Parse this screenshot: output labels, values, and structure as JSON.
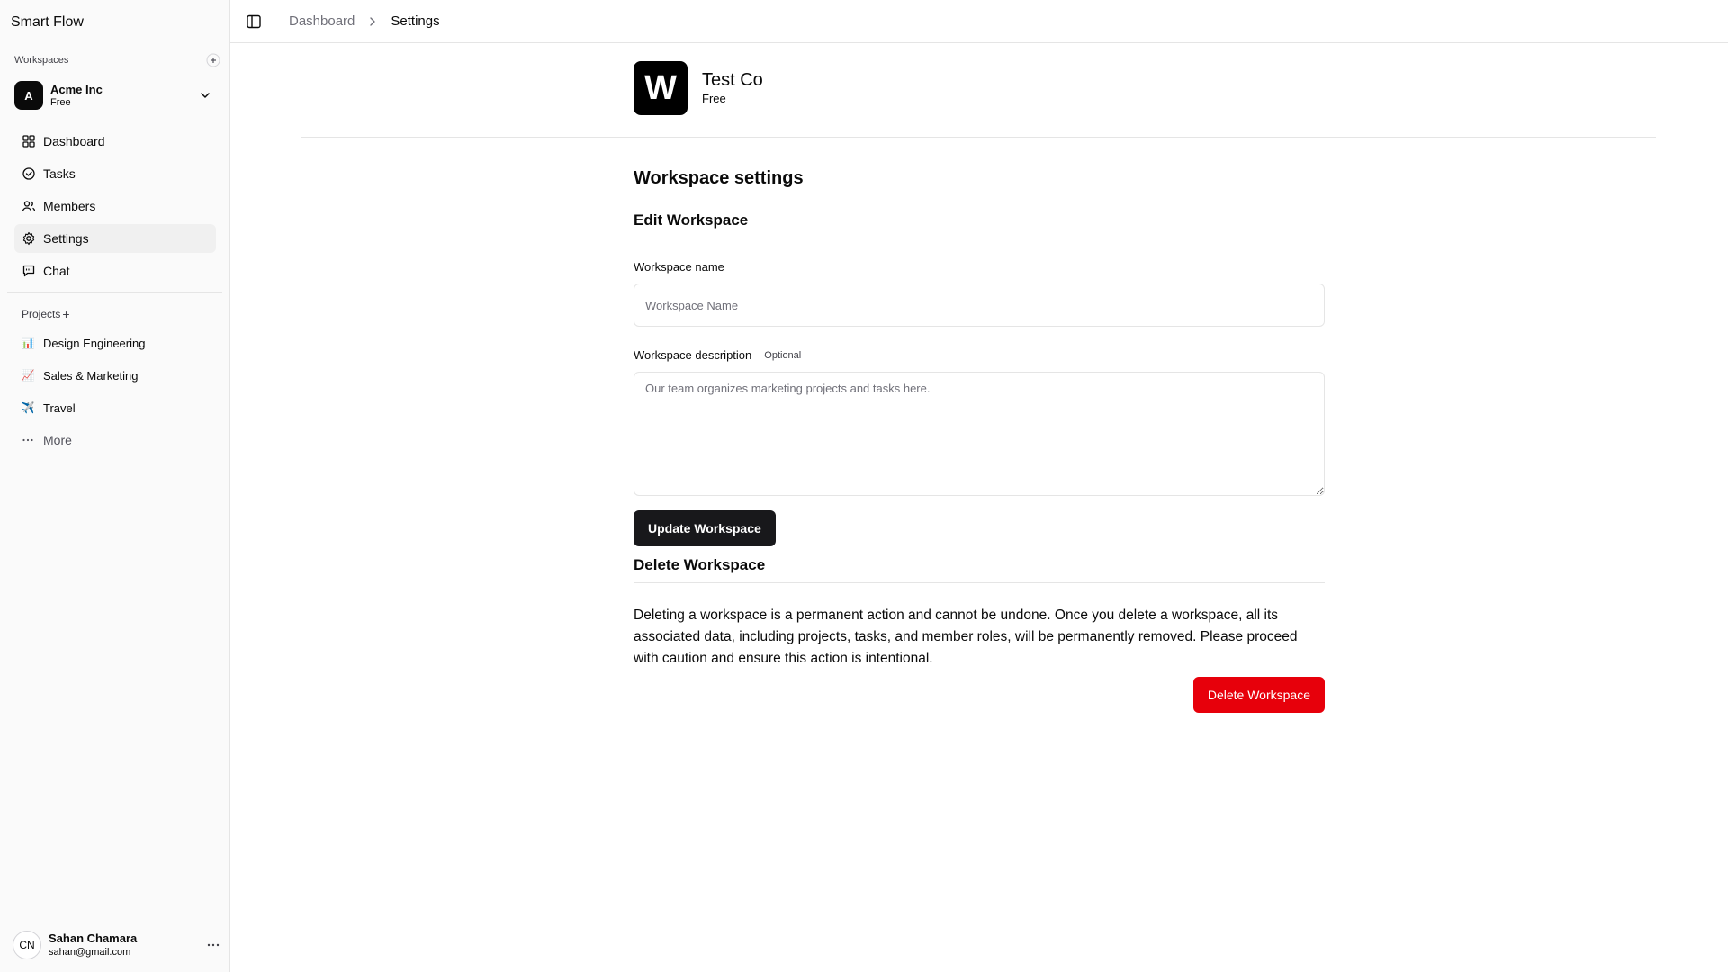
{
  "app": {
    "title": "Smart Flow"
  },
  "sidebar": {
    "workspaces_label": "Workspaces",
    "workspace": {
      "avatar_letter": "A",
      "name": "Acme Inc",
      "plan": "Free"
    },
    "nav": [
      {
        "label": "Dashboard",
        "icon": "dashboard-icon"
      },
      {
        "label": "Tasks",
        "icon": "check-circle-icon"
      },
      {
        "label": "Members",
        "icon": "users-icon"
      },
      {
        "label": "Settings",
        "icon": "gear-icon",
        "active": true
      },
      {
        "label": "Chat",
        "icon": "message-icon"
      }
    ],
    "projects_label": "Projects",
    "projects_add": "+",
    "projects": [
      {
        "emoji": "📊",
        "label": "Design Engineering"
      },
      {
        "emoji": "📈",
        "label": "Sales & Marketing"
      },
      {
        "emoji": "✈️",
        "label": "Travel"
      }
    ],
    "more_label": "More",
    "user": {
      "initials": "CN",
      "name": "Sahan Chamara",
      "email": "sahan@gmail.com"
    }
  },
  "topbar": {
    "breadcrumb": [
      {
        "label": "Dashboard"
      },
      {
        "label": "Settings"
      }
    ]
  },
  "workspace_header": {
    "logo_letter": "W",
    "name": "Test Co",
    "plan": "Free"
  },
  "settings": {
    "page_title": "Workspace settings",
    "edit_section_title": "Edit Workspace",
    "name_label": "Workspace name",
    "name_placeholder": "Workspace Name",
    "name_value": "",
    "description_label": "Workspace description",
    "description_optional": "Optional",
    "description_placeholder": "Our team organizes marketing projects and tasks here.",
    "update_button": "Update Workspace",
    "delete_section_title": "Delete Workspace",
    "delete_warning": "Deleting a workspace is a permanent action and cannot be undone. Once you delete a workspace, all its associated data, including projects, tasks, and member roles, will be permanently removed. Please proceed with caution and ensure this action is intentional.",
    "delete_button": "Delete Workspace"
  },
  "colors": {
    "accent_dark": "#18181b",
    "danger": "#e7000b",
    "sidebar_bg": "#fafafa",
    "border": "#e5e5e5"
  }
}
